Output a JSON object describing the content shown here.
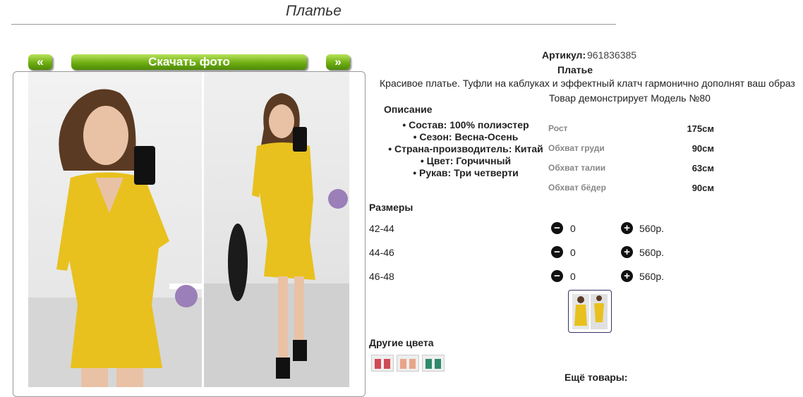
{
  "page": {
    "title": "Платье"
  },
  "gallery": {
    "prev_label": "«",
    "download_label": "Скачать фото",
    "next_label": "»"
  },
  "product": {
    "article_label": "Артикул:",
    "article_value": "961836385",
    "name": "Платье",
    "description": "Красивое платье. Туфли на каблуках и эффектный клатч гармонично дополнят ваш образ",
    "model_note": "Товар демонстрирует Модель №80"
  },
  "description": {
    "heading": "Описание",
    "specs": [
      "Состав: 100% полиэстер",
      "Сезон: Весна-Осень",
      "Страна-производитель: Китай",
      "Цвет: Горчичный",
      "Рукав: Три четверти"
    ]
  },
  "measurements": [
    {
      "label": "Рост",
      "value": "175см"
    },
    {
      "label": "Обхват груди",
      "value": "90см"
    },
    {
      "label": "Обхват талии",
      "value": "63см"
    },
    {
      "label": "Обхват бёдер",
      "value": "90см"
    }
  ],
  "sizes": {
    "heading": "Размеры",
    "rows": [
      {
        "size": "42-44",
        "qty": "0",
        "price": "560р."
      },
      {
        "size": "44-46",
        "qty": "0",
        "price": "560р."
      },
      {
        "size": "46-48",
        "qty": "0",
        "price": "560р."
      }
    ],
    "minus_icon": "minus-circle-icon",
    "plus_icon": "plus-circle-icon"
  },
  "other_colors": {
    "heading": "Другие цвета"
  },
  "more_products": {
    "heading": "Ещё товары:"
  },
  "colors": {
    "dress": "#e8c11e",
    "button_green": "#6fae13"
  }
}
